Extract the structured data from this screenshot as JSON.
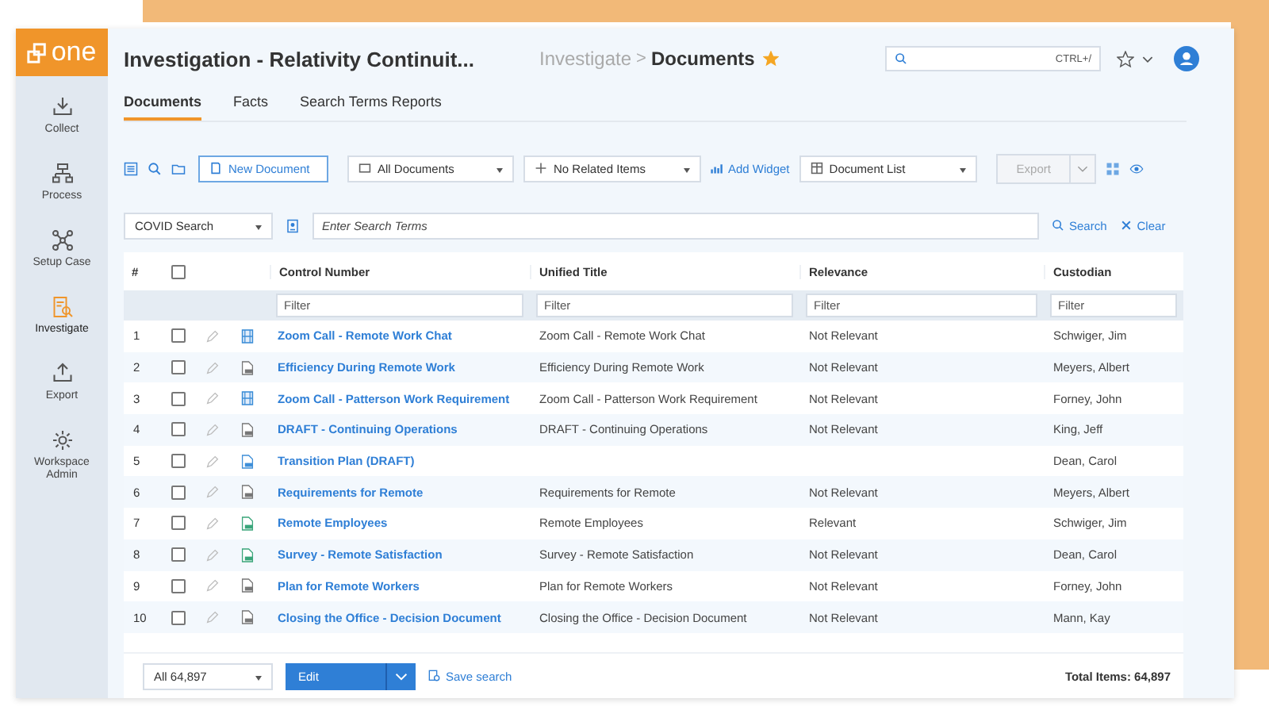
{
  "logo": {
    "text": "one"
  },
  "sidebar": {
    "items": [
      {
        "label": "Collect",
        "selected": false
      },
      {
        "label": "Process",
        "selected": false
      },
      {
        "label": "Setup Case",
        "selected": false
      },
      {
        "label": "Investigate",
        "selected": true
      },
      {
        "label": "Export",
        "selected": false
      },
      {
        "label": "Workspace Admin",
        "selected": false
      }
    ]
  },
  "header": {
    "title": "Investigation - Relativity Continuit...",
    "breadcrumb_parent": "Investigate",
    "breadcrumb_separator": ">",
    "breadcrumb_current": "Documents",
    "favorite": true,
    "search_shortcut": "CTRL+/"
  },
  "tabs": [
    {
      "label": "Documents",
      "selected": true
    },
    {
      "label": "Facts",
      "selected": false
    },
    {
      "label": "Search Terms Reports",
      "selected": false
    }
  ],
  "toolbar": {
    "new_document": "New Document",
    "view_dropdown": "All Documents",
    "related_dropdown": "No Related Items",
    "add_widget": "Add Widget",
    "layout_dropdown": "Document List",
    "export": "Export",
    "export_disabled": true
  },
  "search_bar": {
    "search_type": "COVID Search",
    "placeholder": "Enter Search Terms",
    "search": "Search",
    "clear": "Clear"
  },
  "table": {
    "columns": [
      "#",
      "Control Number",
      "Unified Title",
      "Relevance",
      "Custodian"
    ],
    "filter_placeholders": [
      "Filter",
      "Filter",
      "Filter",
      "Filter"
    ],
    "select_all_checked": false,
    "rows": [
      {
        "number": "1",
        "kind": "video",
        "control_number": "Zoom Call - Remote Work Chat",
        "unified_title": "Zoom Call - Remote Work Chat",
        "relevance": "Not Relevant",
        "custodian": "Schwiger, Jim",
        "checked": false
      },
      {
        "number": "2",
        "kind": "pdf",
        "control_number": "Efficiency During Remote Work",
        "unified_title": "Efficiency During Remote Work",
        "relevance": "Not Relevant",
        "custodian": "Meyers, Albert",
        "checked": false
      },
      {
        "number": "3",
        "kind": "video",
        "control_number": "Zoom Call - Patterson Work Requirement",
        "unified_title": "Zoom Call - Patterson Work Requirement",
        "relevance": "Not Relevant",
        "custodian": "Forney, John",
        "checked": false
      },
      {
        "number": "4",
        "kind": "pdf",
        "control_number": "DRAFT - Continuing Operations",
        "unified_title": "DRAFT - Continuing Operations",
        "relevance": "Not Relevant",
        "custodian": "King, Jeff",
        "checked": false
      },
      {
        "number": "5",
        "kind": "doc",
        "control_number": "Transition Plan (DRAFT)",
        "custodian": "Dean, Carol",
        "checked": false
      },
      {
        "number": "6",
        "kind": "pdf",
        "control_number": "Requirements for Remote",
        "unified_title": "Requirements for Remote",
        "relevance": "Not Relevant",
        "custodian": "Meyers, Albert",
        "checked": false
      },
      {
        "number": "7",
        "kind": "xls",
        "control_number": "Remote Employees",
        "unified_title": "Remote Employees",
        "relevance": "Relevant",
        "custodian": "Schwiger, Jim",
        "checked": false
      },
      {
        "number": "8",
        "kind": "xls",
        "control_number": "Survey - Remote Satisfaction",
        "unified_title": "Survey - Remote Satisfaction",
        "relevance": "Not Relevant",
        "custodian": "Dean, Carol",
        "checked": false
      },
      {
        "number": "9",
        "kind": "pdf",
        "control_number": "Plan for Remote Workers",
        "unified_title": "Plan for Remote Workers",
        "relevance": "Not Relevant",
        "custodian": "Forney, John",
        "checked": false
      },
      {
        "number": "10",
        "kind": "pdf",
        "control_number": "Closing the Office - Decision Document",
        "unified_title": "Closing the Office - Decision Document",
        "relevance": "Not Relevant",
        "custodian": "Mann, Kay",
        "checked": false
      }
    ]
  },
  "footer": {
    "page_size": "All 64,897",
    "edit": "Edit",
    "save_search": "Save search",
    "total": "Total Items: 64,897"
  }
}
